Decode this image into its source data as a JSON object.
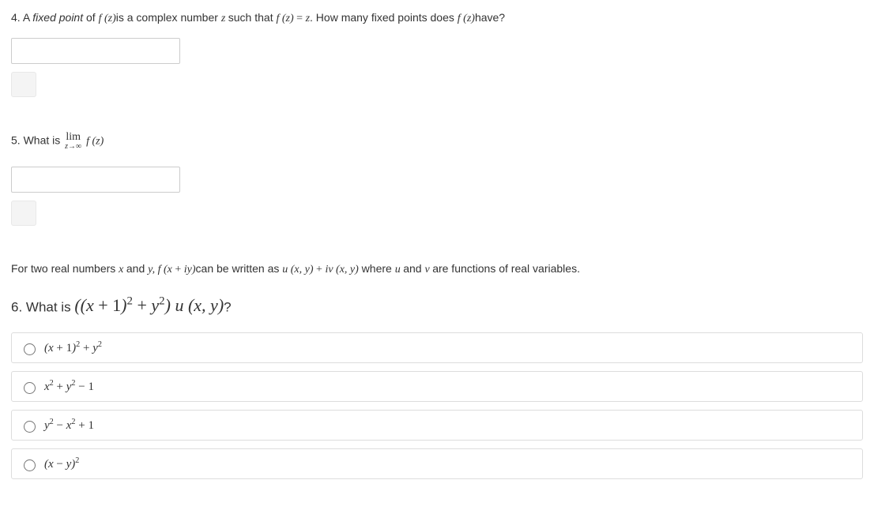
{
  "q4": {
    "num": "4.",
    "pre": "A ",
    "term": "fixed point",
    "mid1": " of ",
    "f1": "f (z)",
    "mid2": "is a complex number ",
    "zvar": "z ",
    "mid3": "such that ",
    "eq": "f (z) = z",
    "mid4": ". How many fixed points does ",
    "f2": "f (z)",
    "tail": "have?"
  },
  "q5": {
    "num": "5.",
    "pre": " What is ",
    "lim": "lim",
    "limsub": "z→∞",
    "fn": "f (z)"
  },
  "intro": {
    "t1": "For two real numbers ",
    "x": "x ",
    "t2": "and ",
    "y": "y,  ",
    "fxy": "f (x + iy)",
    "t3": "can be written as ",
    "uv": "u (x, y) + iv (x, y)",
    "t4": " where ",
    "u": "u ",
    "t5": "and ",
    "v": "v ",
    "t6": "are functions of real variables."
  },
  "q6": {
    "num": "6.",
    "pre": " What is ",
    "expr": "((x + 1)² + y²) u (x, y)",
    "tail": "?"
  },
  "options": {
    "a": "(x + 1)² + y²",
    "b": "x² + y² − 1",
    "c": "y² − x² + 1",
    "d": "(x − y)²"
  }
}
